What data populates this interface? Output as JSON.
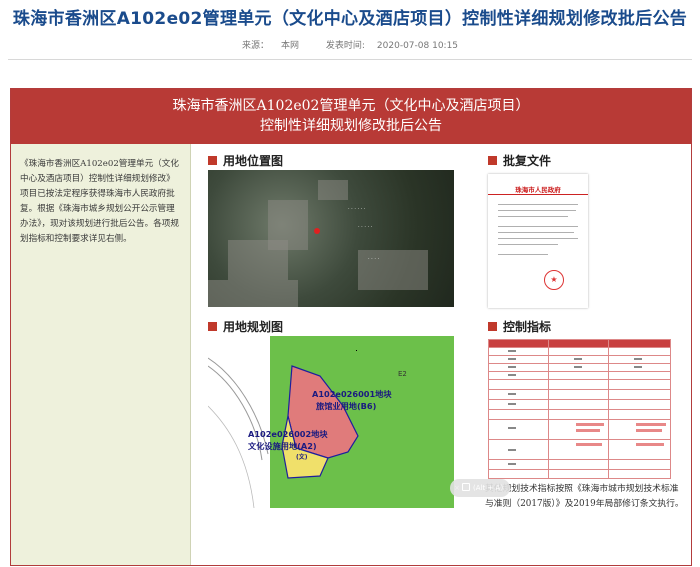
{
  "header": {
    "title": "珠海市香洲区A102e02管理单元（文化中心及酒店项目）控制性详细规划修改批后公告",
    "source_label": "来源：",
    "source_value": "本网",
    "published_label": "发表时间:",
    "published_value": "2020-07-08 10:15"
  },
  "banner": {
    "line1": "珠海市香洲区A102e02管理单元（文化中心及酒店项目）",
    "line2": "控制性详细规划修改批后公告"
  },
  "sidebar": {
    "text": "《珠海市香洲区A102e02管理单元（文化中心及酒店项目）控制性详细规划修改》项目已按法定程序获得珠海市人民政府批复。根据《珠海市城乡规划公开公示管理办法》，现对该规划进行批后公告。各项规划指标和控制要求详见右侧。"
  },
  "sections": {
    "location": "用地位置图",
    "approval": "批复文件",
    "plan": "用地规划图",
    "indicators": "控制指标"
  },
  "approval_doc": {
    "issuer": "珠海市人民政府"
  },
  "plan_map": {
    "zone": "E2",
    "parcel1_line1": "A102e026001地块",
    "parcel1_line2": "旅馆业用地(B6)",
    "parcel2_line1": "A102e026002地块",
    "parcel2_line2": "文化设施用地(A2)",
    "parcel2_code": "(文)"
  },
  "footnote": "其他规划技术指标按照《珠海市城市规划技术标准与准则（2017版）》及2019年局部修订条文执行。",
  "translate_tooltip": {
    "close": "×",
    "label": "(Alt + A)"
  },
  "colors": {
    "title": "#1a4b8c",
    "banner": "#b83a36",
    "sidebar_bg": "#eef1dc",
    "accent": "#c0392b",
    "parcel_hotel": "#e07b7b",
    "parcel_green": "#6cc04a",
    "boundary": "#1e1e9e"
  }
}
